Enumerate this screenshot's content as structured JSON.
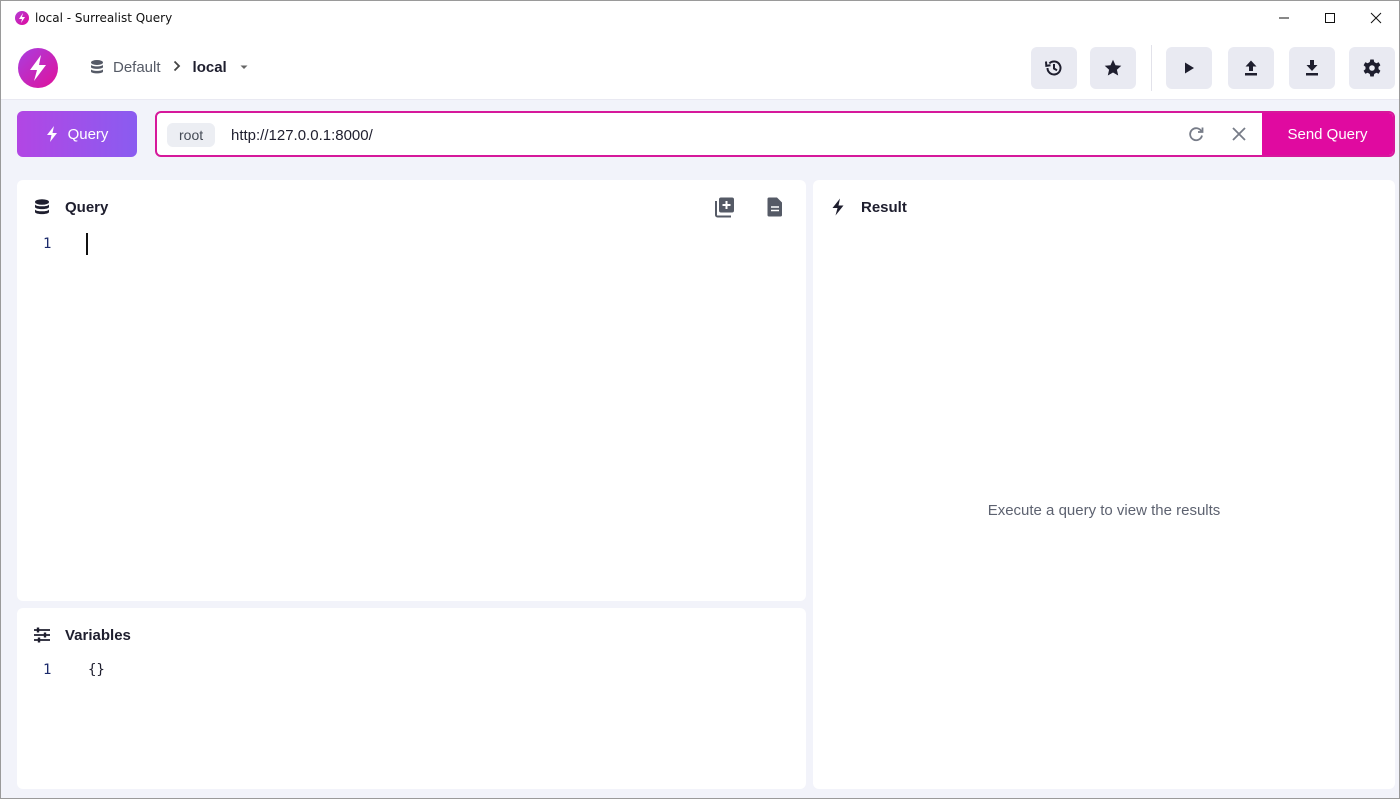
{
  "window": {
    "title": "local - Surrealist Query",
    "controls": [
      "minimize-icon",
      "maximize-icon",
      "close-icon"
    ]
  },
  "header": {
    "breadcrumb": {
      "namespace": "Default",
      "environment": "local"
    },
    "buttons": [
      "history-icon",
      "star-icon",
      "play-icon",
      "upload-icon",
      "download-icon",
      "gear-icon"
    ]
  },
  "query_bar": {
    "mode_label": "Query",
    "user": "root",
    "url": "http://127.0.0.1:8000/",
    "send_label": "Send Query"
  },
  "query_panel": {
    "title": "Query",
    "lines": [
      {
        "number": "1",
        "text": ""
      }
    ]
  },
  "variables_panel": {
    "title": "Variables",
    "lines": [
      {
        "number": "1",
        "text": "{}"
      }
    ]
  },
  "result_panel": {
    "title": "Result",
    "empty_message": "Execute a query to view the results"
  },
  "colors": {
    "accent": "#e00aa0",
    "accent_gradient_start": "#b246e4",
    "accent_gradient_end": "#8a5cf0",
    "background": "#f2f3fa"
  }
}
